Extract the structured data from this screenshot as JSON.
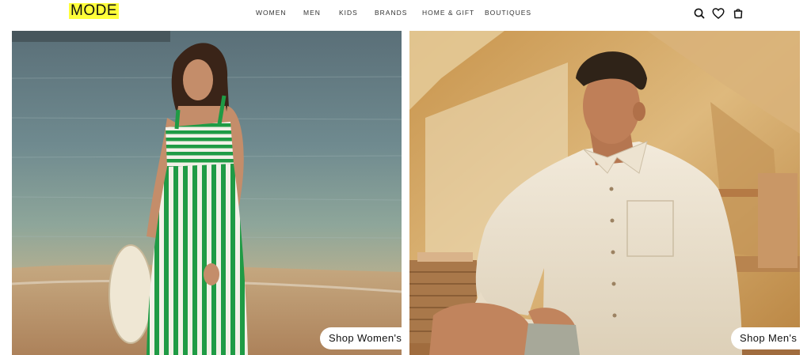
{
  "header": {
    "logo_text": "MODE",
    "nav": [
      {
        "label": "WOMEN"
      },
      {
        "label": "MEN"
      },
      {
        "label": "KIDS"
      },
      {
        "label": "BRANDS"
      },
      {
        "label": "HOME & GIFT"
      },
      {
        "label": "BOUTIQUES"
      }
    ],
    "icons": [
      "search-icon",
      "heart-icon",
      "bag-icon"
    ]
  },
  "hero": {
    "left": {
      "cta_label": "Shop Women's",
      "image": "woman-green-striped-dress-beach"
    },
    "right": {
      "cta_label": "Shop Men's",
      "image": "man-linen-shirt-tent"
    }
  },
  "colors": {
    "logo_highlight": "#ffff3a",
    "text": "#111111",
    "nav_text": "#333333"
  }
}
